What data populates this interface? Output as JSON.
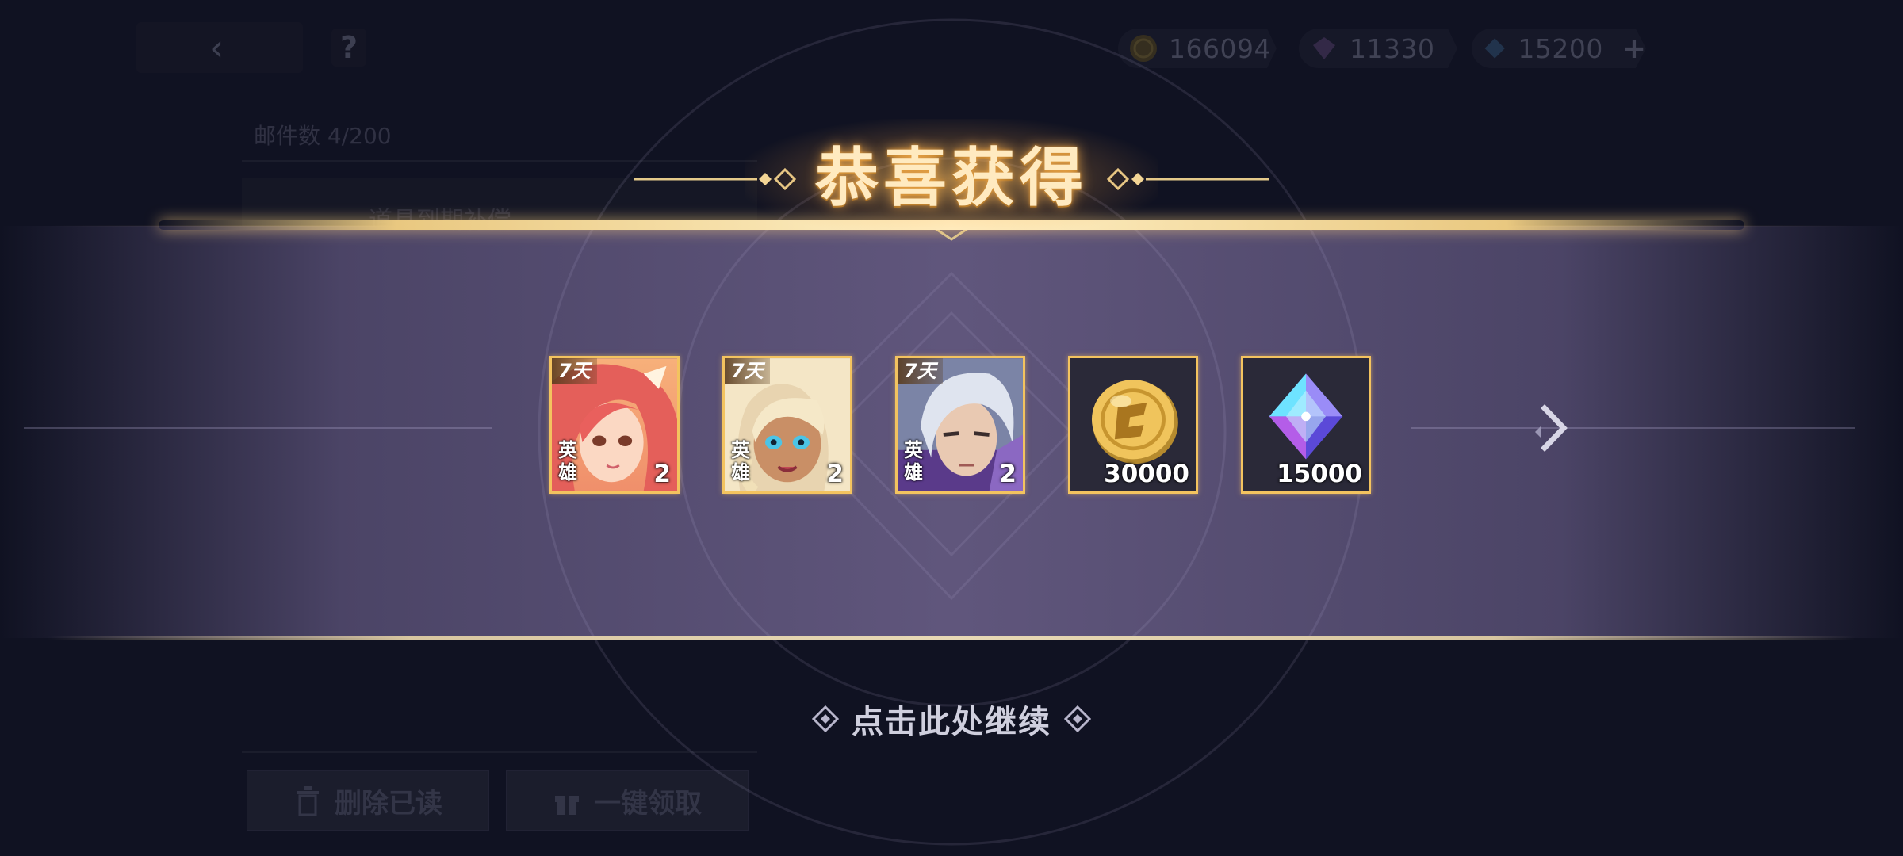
{
  "background": {
    "currencies": [
      {
        "icon": "gold-coin-icon",
        "value": "166094"
      },
      {
        "icon": "purple-gem-icon",
        "value": "11330"
      },
      {
        "icon": "blue-diamond-icon",
        "value": "15200",
        "plus": "+"
      }
    ],
    "mail_count": "邮件数  4/200",
    "mail_item_title": "道具到期补偿",
    "help_label": "?",
    "back_icon": "chevron-left-icon",
    "delete_read_label": "删除已读",
    "claim_all_label": "一键领取"
  },
  "popup": {
    "title": "恭喜获得",
    "continue_label": "点击此处继续",
    "next_icon": "chevron-right-icon",
    "rewards": [
      {
        "type": "hero",
        "days_tag": "7天",
        "hero_tag": "英雄",
        "quantity": "2",
        "art": "pink-hair-hero-portrait"
      },
      {
        "type": "hero",
        "days_tag": "7天",
        "hero_tag": "英雄",
        "quantity": "2",
        "art": "blonde-hero-portrait"
      },
      {
        "type": "hero",
        "days_tag": "7天",
        "hero_tag": "英雄",
        "quantity": "2",
        "art": "silver-hair-hero-portrait"
      },
      {
        "type": "gold",
        "quantity": "30000",
        "art": "gold-coin-icon"
      },
      {
        "type": "diamond",
        "quantity": "15000",
        "art": "diamond-crystal-icon"
      }
    ]
  },
  "colors": {
    "gold_frame": "#f3c35f",
    "title_glow": "#ffb85a",
    "band": "#6e628c"
  }
}
